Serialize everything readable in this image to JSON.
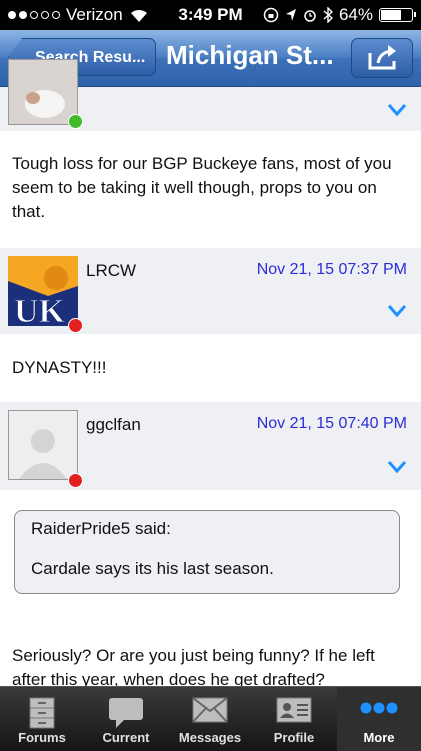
{
  "status": {
    "carrier": "Verizon",
    "time": "3:49 PM",
    "battery": "64%"
  },
  "nav": {
    "back_label": "Search Resu...",
    "title": "Michigan St..."
  },
  "posts": [
    {
      "body": "Tough loss for our BGP Buckeye fans, most of you seem to be taking it well though, props to you on that."
    },
    {
      "username": "LRCW",
      "date": "Nov 21, 15 07:37 PM",
      "body": "DYNASTY!!!"
    },
    {
      "username": "ggclfan",
      "date": "Nov 21, 15 07:40 PM",
      "quote": {
        "author": "RaiderPride5 said:",
        "text": "Cardale says its his last season."
      },
      "body": "Seriously?  Or are you just being funny?  If he left after this year, when does he get drafted?"
    }
  ],
  "tabs": [
    {
      "label": "Forums",
      "icon": "filing-cabinet-icon"
    },
    {
      "label": "Current",
      "icon": "speech-bubble-icon"
    },
    {
      "label": "Messages",
      "icon": "envelope-icon"
    },
    {
      "label": "Profile",
      "icon": "id-card-icon"
    },
    {
      "label": "More",
      "icon": "ellipsis-icon"
    }
  ],
  "colors": {
    "nav_blue": "#3c70b8",
    "date_blue": "#2c2cd8",
    "online": "#3dbb2a",
    "offline": "#e1201f",
    "accent": "#1e90ff"
  }
}
